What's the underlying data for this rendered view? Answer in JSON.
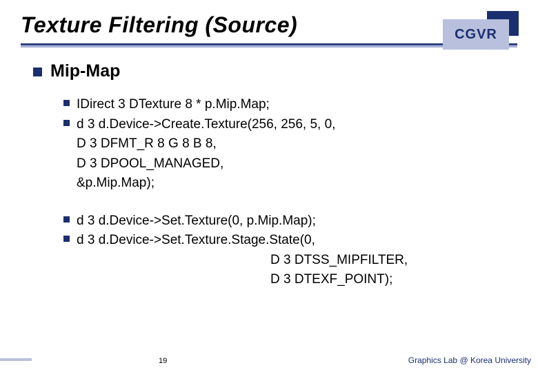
{
  "header": {
    "title": "Texture Filtering (Source)",
    "badge": "CGVR"
  },
  "main": {
    "heading": "Mip-Map",
    "group1": {
      "item1": "IDirect 3 DTexture 8 * p.Mip.Map;",
      "item2": "d 3 d.Device->Create.Texture(256, 256, 5, 0,",
      "item2_cont1": "D 3 DFMT_R 8 G 8 B 8,",
      "item2_cont2": "D 3 DPOOL_MANAGED,",
      "item2_cont3": "&p.Mip.Map);"
    },
    "group2": {
      "item1": "d 3 d.Device->Set.Texture(0, p.Mip.Map);",
      "item2": "d 3 d.Device->Set.Texture.Stage.State(0,",
      "item2_cont1": "D 3 DTSS_MIPFILTER,",
      "item2_cont2": "D 3 DTEXF_POINT);"
    }
  },
  "footer": {
    "page": "19",
    "credit": "Graphics Lab @ Korea University"
  }
}
